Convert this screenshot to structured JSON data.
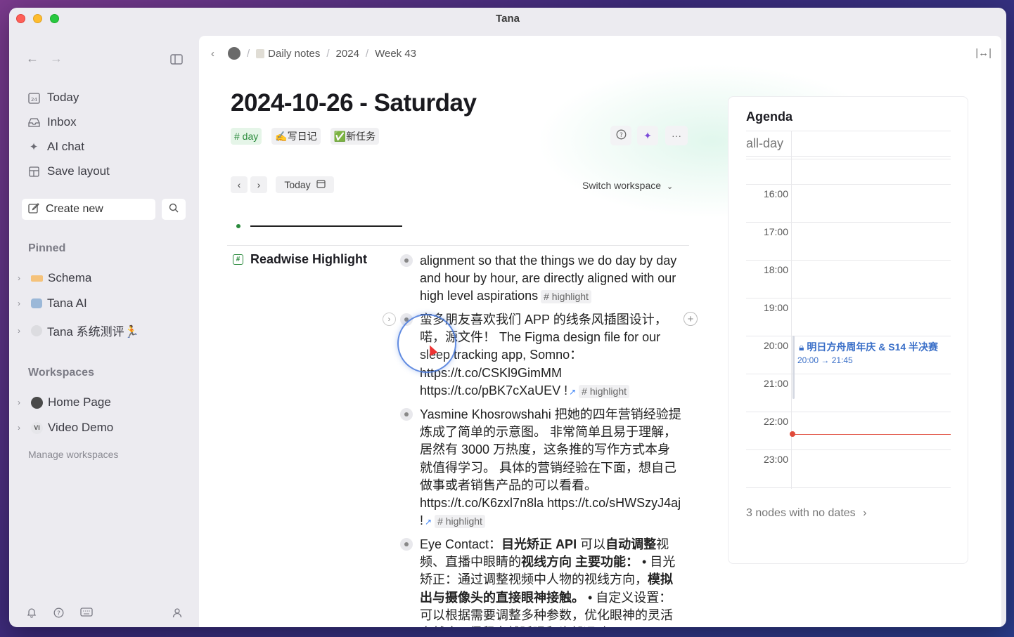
{
  "window": {
    "title": "Tana"
  },
  "sidebar": {
    "nav": [
      {
        "label": "Today",
        "icon": "calendar-icon"
      },
      {
        "label": "Inbox",
        "icon": "inbox-icon"
      },
      {
        "label": "AI chat",
        "icon": "sparkle-icon"
      },
      {
        "label": "Save layout",
        "icon": "layout-icon"
      }
    ],
    "create_new": "Create new",
    "pinned_heading": "Pinned",
    "pinned": [
      {
        "label": "Schema",
        "icon": "schema-tag-icon"
      },
      {
        "label": "Tana AI",
        "icon": "robot-icon"
      },
      {
        "label": "Tana 系统测评🏃",
        "icon": "circle-icon"
      }
    ],
    "workspaces_heading": "Workspaces",
    "workspaces": [
      {
        "label": "Home Page",
        "avatar": ""
      },
      {
        "label": "Video Demo",
        "avatar": "VI"
      }
    ],
    "manage_workspaces": "Manage workspaces"
  },
  "breadcrumb": [
    "Daily notes",
    "2024",
    "Week 43"
  ],
  "page": {
    "title": "2024-10-26 - Saturday",
    "tags": [
      {
        "label": "# day",
        "style": "day"
      },
      {
        "label": "✍️写日记",
        "style": "gray"
      },
      {
        "label": "✅新任务",
        "style": "gray"
      }
    ],
    "date_nav": {
      "today": "Today"
    },
    "switch_workspace": "Switch workspace"
  },
  "field": {
    "name": "Readwise Highlight"
  },
  "nodes": [
    {
      "text": "alignment so that the things we do day by day and hour by hour, are directly aligned with our high level aspirations",
      "tag": "# highlight"
    },
    {
      "text": "蛮多朋友喜欢我们 APP 的线条风插图设计，喏，源文件！   The Figma design file for our sleep tracking app, Somno： https://t.co/CSKl9GimMM https://t.co/pBK7cXaUEV  !",
      "tag": "# highlight"
    },
    {
      "text": "Yasmine Khosrowshahi 把她的四年营销经验提炼成了简单的示意图。  非常简单且易于理解，居然有 3000 万热度，这条推的写作方式本身就值得学习。  具体的营销经验在下面，想自己做事或者销售产品的可以看看。 https://t.co/K6zxl7n8la https://t.co/sHWSzyJ4aj  !",
      "tag": "# highlight"
    },
    {
      "text_parts": [
        {
          "t": "Eye Contact：",
          "b": false
        },
        {
          "t": "目光矫正 API",
          "b": true
        },
        {
          "t": "   可以",
          "b": false
        },
        {
          "t": "自动调整",
          "b": true
        },
        {
          "t": "视频、直播中眼睛的",
          "b": false
        },
        {
          "t": "视线方向  主要功能：",
          "b": true
        },
        {
          "t": "   • 目光矫正：通过调整视频中人物的视线方向，",
          "b": false
        },
        {
          "t": "模拟出与摄像头的直接眼神接触。",
          "b": true
        },
        {
          "t": "  • 自定义设置：可以根据需要调整多种参数，优化眼神的",
          "b": false
        },
        {
          "t": "灵活自然度   • 保留自然眨眼和头部运动",
          "b": false
        }
      ]
    }
  ],
  "agenda": {
    "title": "Agenda",
    "all_day": "all-day",
    "times": [
      "16:00",
      "17:00",
      "18:00",
      "19:00",
      "20:00",
      "21:00",
      "22:00",
      "23:00"
    ],
    "event": {
      "title": "明日方舟周年庆 & S14 半决赛",
      "time": "20:00 → 21:45"
    },
    "footer": "3 nodes with no dates"
  },
  "colors": {
    "accent_green": "#2a8a3c",
    "event_blue": "#3a6fc8",
    "now_red": "#e04a3a"
  }
}
